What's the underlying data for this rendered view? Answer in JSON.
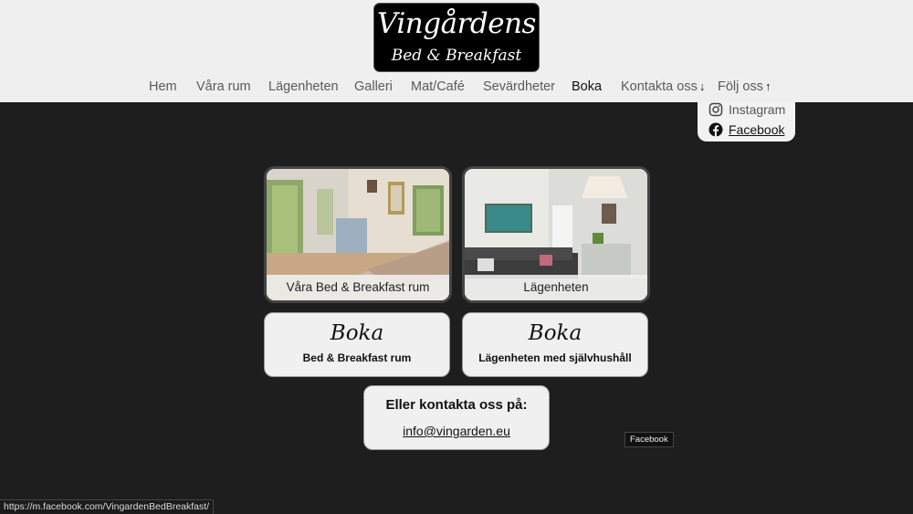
{
  "logo": {
    "name": "Vingårdens",
    "subtitle": "Bed & Breakfast"
  },
  "nav": {
    "items": [
      "Hem",
      "Våra rum",
      "Lägenheten",
      "Galleri",
      "Mat/Café",
      "Sevärdheter",
      "Boka",
      "Kontakta oss",
      "Följ oss"
    ],
    "active": "Boka",
    "contact_arrow": "↓",
    "follow_arrow": "↑"
  },
  "dropdown": {
    "items": [
      {
        "label": "Instagram",
        "icon": "instagram-icon"
      },
      {
        "label": "Facebook",
        "icon": "facebook-icon"
      }
    ]
  },
  "cards": [
    {
      "caption": "Våra Bed & Breakfast rum"
    },
    {
      "caption": "Lägenheten"
    }
  ],
  "boka": [
    {
      "title": "Boka",
      "subtitle": "Bed & Breakfast rum"
    },
    {
      "title": "Boka",
      "subtitle": "Lägenheten med självhushåll"
    }
  ],
  "contact": {
    "title": "Eller kontakta oss på:",
    "email": "info@vingarden.eu"
  },
  "tooltip": "Facebook",
  "status_url": "https://m.facebook.com/VingardenBedBreakfast/",
  "colors": {
    "header_bg": "#efefef",
    "page_bg": "#1e1e1e",
    "button_bg": "#f0f0f0"
  }
}
